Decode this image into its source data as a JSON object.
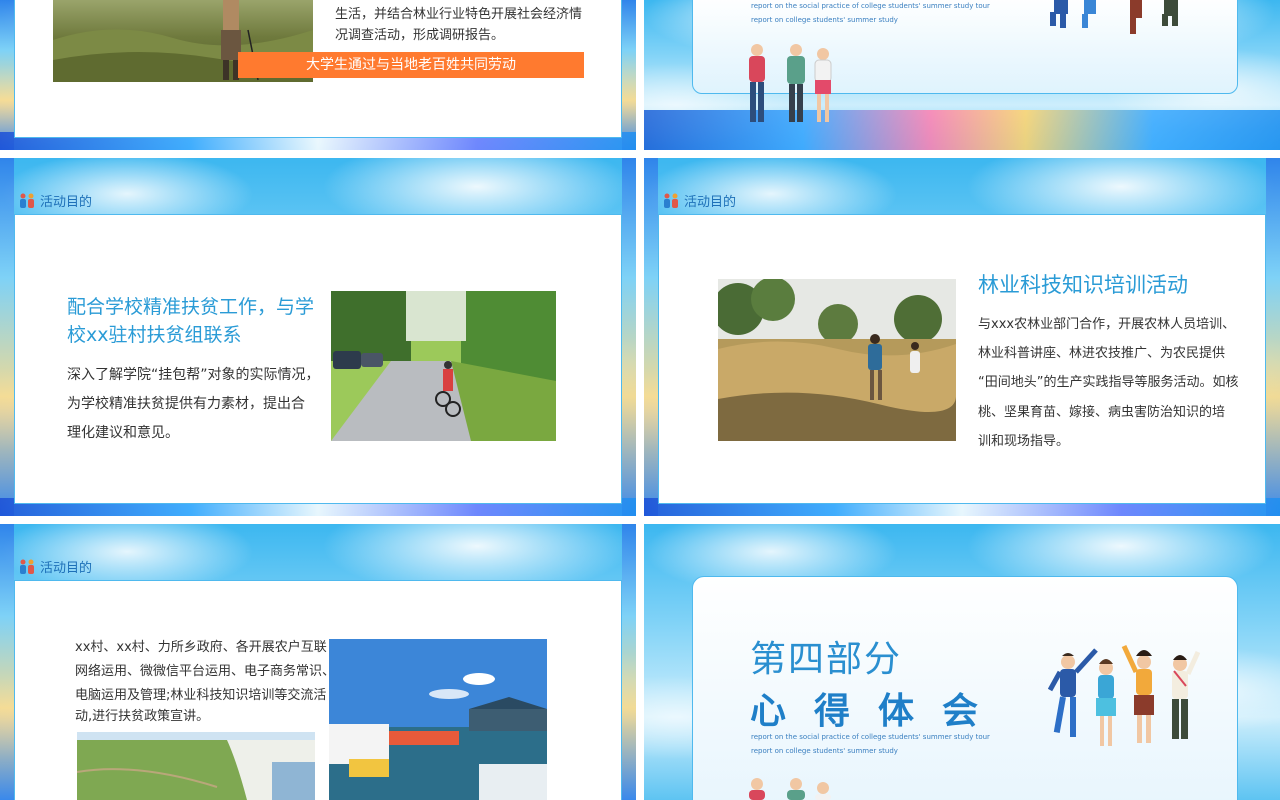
{
  "slide_tl": {
    "body_lines": [
      "生活，并结合林业行业特色开展社会经济情",
      "况调查活动，形成调研报告。"
    ],
    "caption": "大学生通过与当地老百姓共同劳动"
  },
  "slide_tr": {
    "en_lines": [
      "report on the social practice of college students' summer study tour",
      "report on college students' summer study"
    ]
  },
  "slide_ml": {
    "tag": "活动目的",
    "heading_lines": [
      "配合学校精准扶贫工作，与学",
      "校xx驻村扶贫组联系"
    ],
    "body_lines": [
      "深入了解学院“挂包帮”对象的实际情况，",
      "为学校精准扶贫提供有力素材，提出合",
      "理化建议和意见。"
    ]
  },
  "slide_mr": {
    "tag": "活动目的",
    "heading": "林业科技知识培训活动",
    "body_lines": [
      "与xxx农林业部门合作，开展农林人员培训、",
      "林业科普讲座、林进农技推广、为农民提供",
      "“田间地头”的生产实践指导等服务活动。如核",
      "桃、坚果育苗、嫁接、病虫害防治知识的培",
      "训和现场指导。"
    ]
  },
  "slide_bl": {
    "tag": "活动目的",
    "body_lines": [
      "xx村、xx村、力所乡政府、各开展农户互联",
      "网络运用、微微信平台运用、电子商务常识、",
      "电脑运用及管理;林业科技知识培训等交流活",
      "动,进行扶贫政策宣讲。"
    ]
  },
  "slide_br": {
    "section_number": "第四部分",
    "section_title": "心得体会",
    "en_lines": [
      "report on the social practice of college students' summer study tour",
      "report on college students' summer study"
    ]
  },
  "colors": {
    "accent_blue": "#2a9bd6",
    "caption_orange": "#ff7a2f",
    "card_border": "#4fb9ee"
  }
}
